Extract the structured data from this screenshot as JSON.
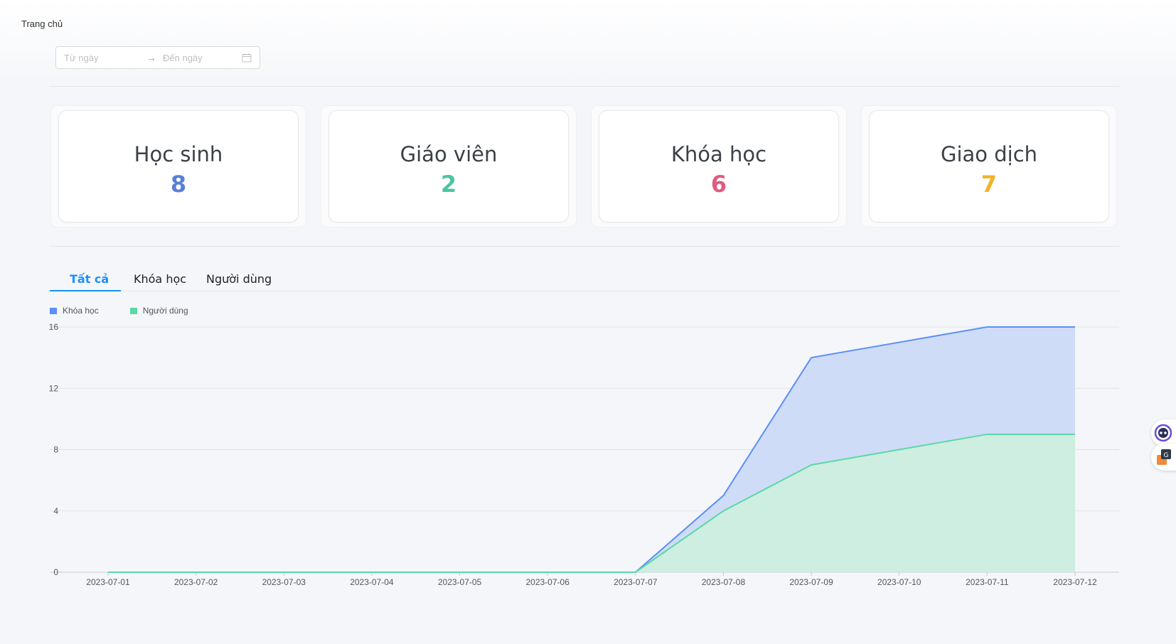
{
  "breadcrumb": {
    "label": "Trang chủ"
  },
  "date_range": {
    "from_placeholder": "Từ ngày",
    "arrow": "→",
    "to_placeholder": "Đến ngày"
  },
  "stats": [
    {
      "title": "Học sinh",
      "value": "8",
      "color": "#5b7fd6"
    },
    {
      "title": "Giáo viên",
      "value": "2",
      "color": "#4cc5a2"
    },
    {
      "title": "Khóa học",
      "value": "6",
      "color": "#e05b7f"
    },
    {
      "title": "Giao dịch",
      "value": "7",
      "color": "#f0b429"
    }
  ],
  "tabs": [
    {
      "label": "Tất cả",
      "active": true
    },
    {
      "label": "Khóa học",
      "active": false
    },
    {
      "label": "Người dùng",
      "active": false
    }
  ],
  "chart_data": {
    "type": "area",
    "categories": [
      "2023-07-01",
      "2023-07-02",
      "2023-07-03",
      "2023-07-04",
      "2023-07-05",
      "2023-07-06",
      "2023-07-07",
      "2023-07-08",
      "2023-07-09",
      "2023-07-10",
      "2023-07-11",
      "2023-07-12"
    ],
    "series": [
      {
        "name": "Khóa học",
        "values": [
          0,
          0,
          0,
          0,
          0,
          0,
          0,
          5,
          14,
          15,
          16,
          16
        ],
        "color": "#5b8ff9",
        "fill": "#cfdcf7"
      },
      {
        "name": "Người dùng",
        "values": [
          0,
          0,
          0,
          0,
          0,
          0,
          0,
          4,
          7,
          8,
          9,
          9
        ],
        "color": "#5ad8a6",
        "fill": "#cdeee0"
      }
    ],
    "stacked": false,
    "ylim": [
      0,
      16
    ],
    "yticks": [
      0,
      4,
      8,
      12,
      16
    ],
    "legend_position": "top-left",
    "grid": true
  }
}
